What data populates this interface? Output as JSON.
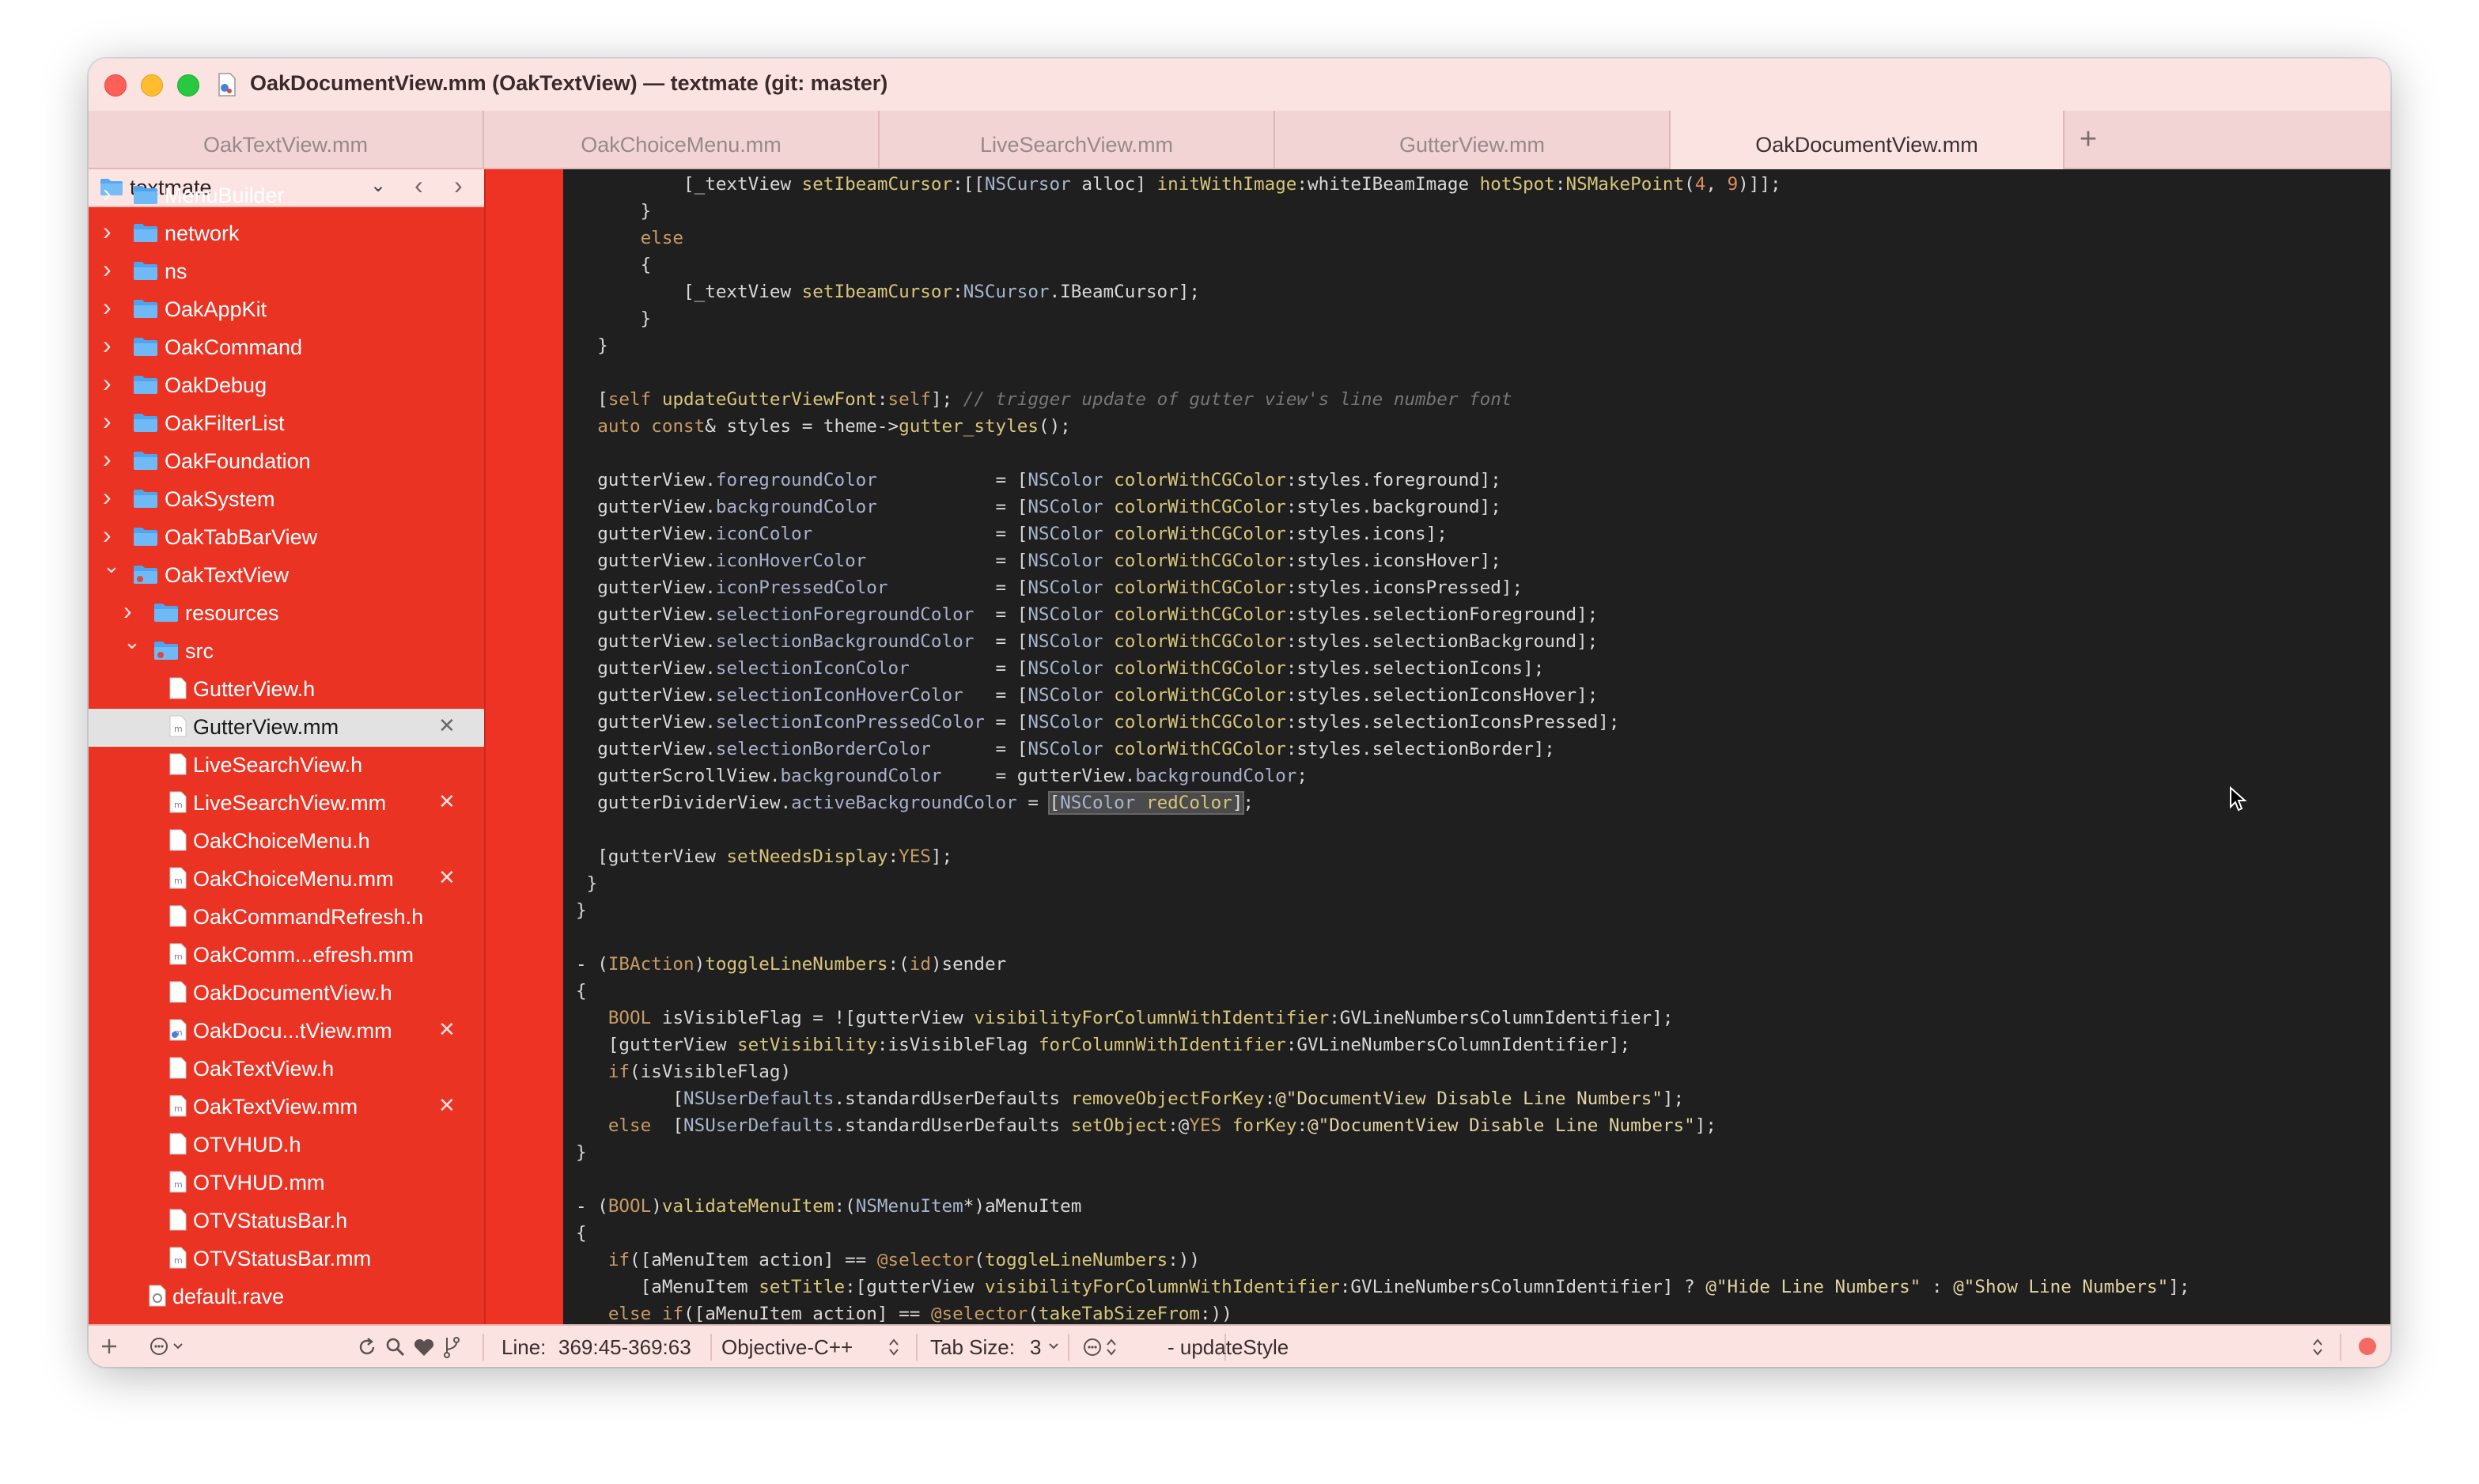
{
  "window": {
    "title": "OakDocumentView.mm (OakTextView) — textmate (git: master)"
  },
  "tabs": [
    {
      "label": "OakTextView.mm",
      "active": false
    },
    {
      "label": "OakChoiceMenu.mm",
      "active": false
    },
    {
      "label": "LiveSearchView.mm",
      "active": false
    },
    {
      "label": "GutterView.mm",
      "active": false
    },
    {
      "label": "OakDocumentView.mm",
      "active": true
    }
  ],
  "tab_add": "+",
  "sidebar": {
    "project": "textmate",
    "back": "‹",
    "forward": "›",
    "items": [
      {
        "label": "MenuBuilder",
        "type": "folder"
      },
      {
        "label": "network",
        "type": "folder"
      },
      {
        "label": "ns",
        "type": "folder"
      },
      {
        "label": "OakAppKit",
        "type": "folder"
      },
      {
        "label": "OakCommand",
        "type": "folder"
      },
      {
        "label": "OakDebug",
        "type": "folder"
      },
      {
        "label": "OakFilterList",
        "type": "folder"
      },
      {
        "label": "OakFoundation",
        "type": "folder"
      },
      {
        "label": "OakSystem",
        "type": "folder"
      },
      {
        "label": "OakTabBarView",
        "type": "folder"
      },
      {
        "label": "OakTextView",
        "type": "folder"
      },
      {
        "label": "resources",
        "type": "folder"
      },
      {
        "label": "src",
        "type": "folder"
      },
      {
        "label": "GutterView.h",
        "type": "file"
      },
      {
        "label": "GutterView.mm",
        "type": "file",
        "selected": true
      },
      {
        "label": "LiveSearchView.h",
        "type": "file"
      },
      {
        "label": "LiveSearchView.mm",
        "type": "file"
      },
      {
        "label": "OakChoiceMenu.h",
        "type": "file"
      },
      {
        "label": "OakChoiceMenu.mm",
        "type": "file"
      },
      {
        "label": "OakCommandRefresh.h",
        "type": "file"
      },
      {
        "label": "OakComm...efresh.mm",
        "type": "file"
      },
      {
        "label": "OakDocumentView.h",
        "type": "file"
      },
      {
        "label": "OakDocu...tView.mm",
        "type": "file"
      },
      {
        "label": "OakTextView.h",
        "type": "file"
      },
      {
        "label": "OakTextView.mm",
        "type": "file"
      },
      {
        "label": "OTVHUD.h",
        "type": "file"
      },
      {
        "label": "OTVHUD.mm",
        "type": "file"
      },
      {
        "label": "OTVStatusBar.h",
        "type": "file"
      },
      {
        "label": "OTVStatusBar.mm",
        "type": "file"
      },
      {
        "label": "default.rave",
        "type": "file"
      }
    ],
    "close_glyph": "✕"
  },
  "code_lines": [
    "          [_textView setIbeamCursor:[[NSCursor alloc] initWithImage:whiteIBeamImage hotSpot:NSMakePoint(4, 9)]];",
    "      }",
    "      else",
    "      {",
    "          [_textView setIbeamCursor:NSCursor.IBeamCursor];",
    "      }",
    "  }",
    "",
    "  [self updateGutterViewFont:self]; // trigger update of gutter view's line number font",
    "  auto const& styles = theme->gutter_styles();",
    "",
    "  gutterView.foregroundColor           = [NSColor colorWithCGColor:styles.foreground];",
    "  gutterView.backgroundColor           = [NSColor colorWithCGColor:styles.background];",
    "  gutterView.iconColor                 = [NSColor colorWithCGColor:styles.icons];",
    "  gutterView.iconHoverColor            = [NSColor colorWithCGColor:styles.iconsHover];",
    "  gutterView.iconPressedColor          = [NSColor colorWithCGColor:styles.iconsPressed];",
    "  gutterView.selectionForegroundColor  = [NSColor colorWithCGColor:styles.selectionForeground];",
    "  gutterView.selectionBackgroundColor  = [NSColor colorWithCGColor:styles.selectionBackground];",
    "  gutterView.selectionIconColor        = [NSColor colorWithCGColor:styles.selectionIcons];",
    "  gutterView.selectionIconHoverColor   = [NSColor colorWithCGColor:styles.selectionIconsHover];",
    "  gutterView.selectionIconPressedColor = [NSColor colorWithCGColor:styles.selectionIconsPressed];",
    "  gutterView.selectionBorderColor      = [NSColor colorWithCGColor:styles.selectionBorder];",
    "  gutterScrollView.backgroundColor     = gutterView.backgroundColor;",
    "  gutterDividerView.activeBackgroundColor = [NSColor redColor];",
    "",
    "  [gutterView setNeedsDisplay:YES];",
    " }",
    "}",
    "",
    "- (IBAction)toggleLineNumbers:(id)sender",
    "{",
    "   BOOL isVisibleFlag = ![gutterView visibilityForColumnWithIdentifier:GVLineNumbersColumnIdentifier];",
    "   [gutterView setVisibility:isVisibleFlag forColumnWithIdentifier:GVLineNumbersColumnIdentifier];",
    "   if(isVisibleFlag)",
    "         [NSUserDefaults.standardUserDefaults removeObjectForKey:@\"DocumentView Disable Line Numbers\"];",
    "   else  [NSUserDefaults.standardUserDefaults setObject:@YES forKey:@\"DocumentView Disable Line Numbers\"];",
    "}",
    "",
    "- (BOOL)validateMenuItem:(NSMenuItem*)aMenuItem",
    "{",
    "   if([aMenuItem action] == @selector(toggleLineNumbers:))",
    "      [aMenuItem setTitle:[gutterView visibilityForColumnWithIdentifier:GVLineNumbersColumnIdentifier] ? @\"Hide Line Numbers\" : @\"Show Line Numbers\"];",
    "   else if([aMenuItem action] == @selector(takeTabSizeFrom:))"
  ],
  "statusbar": {
    "line_label": "Line:",
    "line_value": "369:45-369:63",
    "language": "Objective-C++",
    "tab_size_label": "Tab Size:",
    "tab_size_value": "3",
    "symbol": "- updateStyle"
  },
  "icons": {
    "add": "plus-icon",
    "action": "gear-icon",
    "reload": "reload-icon",
    "search": "search-icon",
    "favorites": "heart-icon",
    "scm": "branch-icon",
    "record": "record-icon"
  },
  "colors": {
    "sidebar_bg": "#eb3323",
    "editor_bg": "#1f1f1f",
    "chrome_bg": "#fbe3e2"
  }
}
